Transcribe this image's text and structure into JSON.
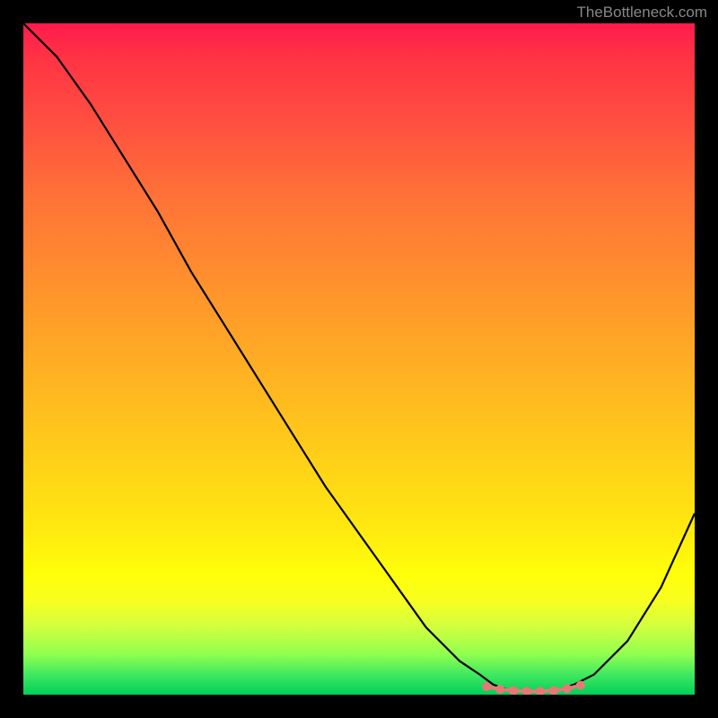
{
  "watermark": "TheBottleneck.com",
  "chart_data": {
    "type": "line",
    "title": "",
    "xlabel": "",
    "ylabel": "",
    "xlim": [
      0,
      100
    ],
    "ylim": [
      0,
      100
    ],
    "series": [
      {
        "name": "bottleneck-curve",
        "x": [
          0,
          5,
          10,
          15,
          20,
          25,
          30,
          35,
          40,
          45,
          50,
          55,
          60,
          65,
          68,
          70,
          72,
          75,
          78,
          80,
          82,
          85,
          90,
          95,
          100
        ],
        "y": [
          100,
          95,
          88,
          80,
          72,
          63,
          55,
          47,
          39,
          31,
          24,
          17,
          10,
          5,
          3,
          1.5,
          0.8,
          0.5,
          0.5,
          0.8,
          1.5,
          3,
          8,
          16,
          27
        ]
      }
    ],
    "markers": {
      "name": "optimal-range",
      "x": [
        69,
        71,
        73,
        75,
        77,
        79,
        81,
        83
      ],
      "y": [
        1.2,
        0.8,
        0.6,
        0.5,
        0.5,
        0.6,
        0.9,
        1.4
      ],
      "color": "#e87878"
    },
    "gradient_colors": {
      "top": "#ff1a4d",
      "middle": "#ffff08",
      "bottom": "#00d058"
    }
  }
}
